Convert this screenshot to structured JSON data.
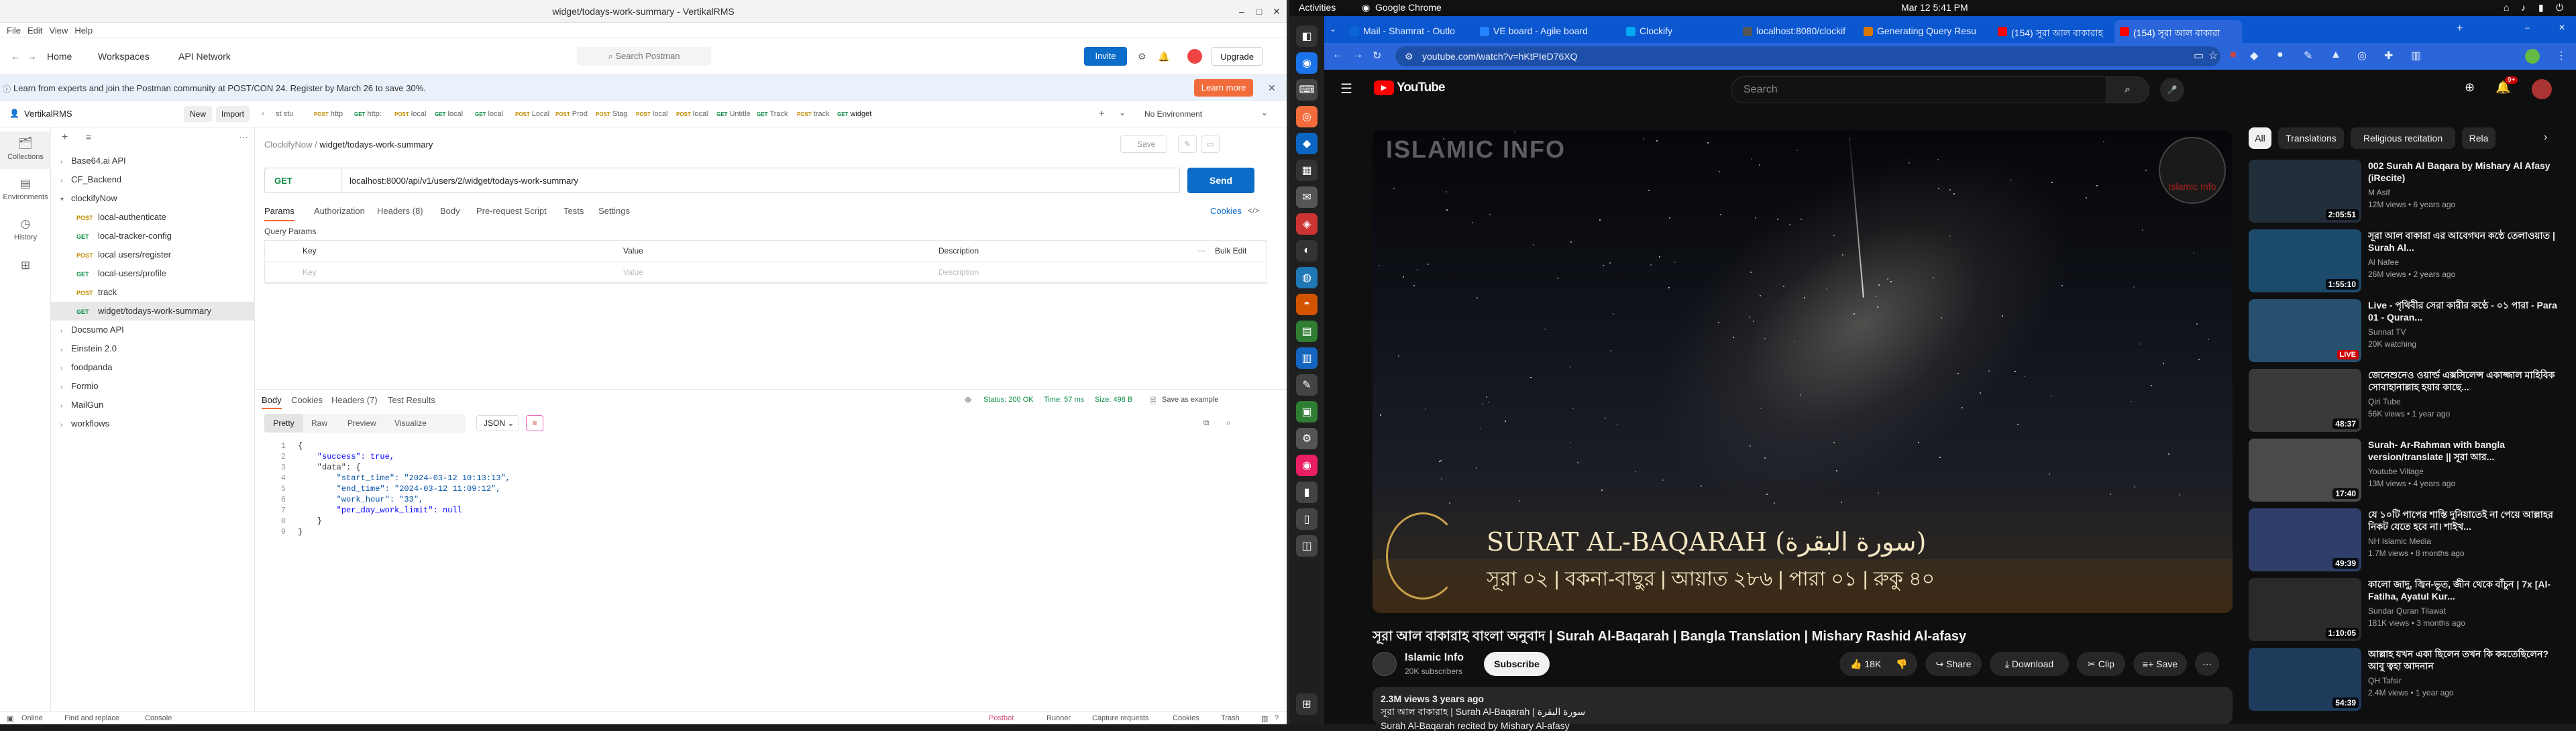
{
  "postman": {
    "window_title": "widget/todays-work-summary - VertikalRMS",
    "menu": [
      "File",
      "Edit",
      "View",
      "Help"
    ],
    "header": {
      "home": "Home",
      "workspaces": "Workspaces",
      "api_network": "API Network",
      "search_placeholder": "Search Postman",
      "invite": "Invite",
      "upgrade": "Upgrade"
    },
    "banner": {
      "text": "Learn from experts and join the Postman community at POST/CON 24. Register by March 26 to save 30%.",
      "button": "Learn more"
    },
    "workspace": {
      "name": "VertikalRMS",
      "new": "New",
      "import": "Import"
    },
    "rail": [
      "Collections",
      "Environments",
      "History"
    ],
    "tree": [
      {
        "type": "folder",
        "label": "Base64.ai API",
        "level": 0
      },
      {
        "type": "folder",
        "label": "CF_Backend",
        "level": 0
      },
      {
        "type": "folder",
        "label": "clockifyNow",
        "level": 0,
        "open": true
      },
      {
        "type": "req",
        "method": "POST",
        "label": "local-authenticate",
        "level": 1
      },
      {
        "type": "req",
        "method": "GET",
        "label": "local-tracker-config",
        "level": 1
      },
      {
        "type": "req",
        "method": "POST",
        "label": "local users/register",
        "level": 1
      },
      {
        "type": "req",
        "method": "GET",
        "label": "local-users/profile",
        "level": 1
      },
      {
        "type": "req",
        "method": "POST",
        "label": "track",
        "level": 1
      },
      {
        "type": "req",
        "method": "GET",
        "label": "widget/todays-work-summary",
        "level": 1,
        "selected": true
      },
      {
        "type": "folder",
        "label": "Docsumo API",
        "level": 0
      },
      {
        "type": "folder",
        "label": "Einstein 2.0",
        "level": 0
      },
      {
        "type": "folder",
        "label": "foodpanda",
        "level": 0
      },
      {
        "type": "folder",
        "label": "Formio",
        "level": 0
      },
      {
        "type": "folder",
        "label": "MailGun",
        "level": 0
      },
      {
        "type": "folder",
        "label": "workflows",
        "level": 0
      }
    ],
    "tabs": [
      {
        "method": "",
        "label": "st stu"
      },
      {
        "method": "POST",
        "label": "http"
      },
      {
        "method": "GET",
        "label": "http:"
      },
      {
        "method": "POST",
        "label": "local"
      },
      {
        "method": "GET",
        "label": "local"
      },
      {
        "method": "GET",
        "label": "local"
      },
      {
        "method": "POST",
        "label": "Local"
      },
      {
        "method": "POST",
        "label": "Prod"
      },
      {
        "method": "POST",
        "label": "Stag"
      },
      {
        "method": "POST",
        "label": "local"
      },
      {
        "method": "POST",
        "label": "local"
      },
      {
        "method": "GET",
        "label": "Untitle"
      },
      {
        "method": "GET",
        "label": "Track"
      },
      {
        "method": "POST",
        "label": "track"
      },
      {
        "method": "GET",
        "label": "widget"
      }
    ],
    "no_environment": "No Environment",
    "breadcrumb": {
      "parent": "ClockifyNow",
      "current": "widget/todays-work-summary"
    },
    "request": {
      "method": "GET",
      "url": "localhost:8000/api/v1/users/2/widget/todays-work-summary",
      "send": "Send",
      "save": "Save"
    },
    "req_tabs": [
      "Params",
      "Authorization",
      "Headers (8)",
      "Body",
      "Pre-request Script",
      "Tests",
      "Settings"
    ],
    "cookies": "Cookies",
    "query_params": {
      "title": "Query Params",
      "headers": [
        "Key",
        "Value",
        "Description"
      ],
      "bulk_edit": "Bulk Edit",
      "placeholder_row": [
        "Key",
        "Value",
        "Description"
      ]
    },
    "resp_tabs": [
      "Body",
      "Cookies",
      "Headers (7)",
      "Test Results"
    ],
    "resp_status": {
      "status": "Status: 200 OK",
      "time": "Time: 57 ms",
      "size": "Size: 498 B",
      "save": "Save as example"
    },
    "resp_views": [
      "Pretty",
      "Raw",
      "Preview",
      "Visualize"
    ],
    "resp_format": "JSON",
    "code_lines": [
      "{",
      "    \"success\": true,",
      "    \"data\": {",
      "        \"start_time\": \"2024-03-12 10:13:13\",",
      "        \"end_time\": \"2024-03-12 11:09:12\",",
      "        \"work_hour\": \"33\",",
      "        \"per_day_work_limit\": null",
      "    }",
      "}"
    ],
    "status_bar": {
      "online": "Online",
      "find": "Find and replace",
      "console": "Console",
      "postbot": "Postbot",
      "runner": "Runner",
      "capture": "Capture requests",
      "cookies": "Cookies",
      "trash": "Trash"
    }
  },
  "system": {
    "activities": "Activities",
    "app": "Google Chrome",
    "datetime": "Mar 12  5:41 PM"
  },
  "chrome": {
    "tabs": [
      {
        "label": "Mail - Shamrat - Outlo",
        "color": "#0a64d6"
      },
      {
        "label": "VE board - Agile board",
        "color": "#2684ff"
      },
      {
        "label": "Clockify",
        "color": "#03a9f4"
      },
      {
        "label": "localhost:8080/clockif",
        "color": "#555555"
      },
      {
        "label": "Generating Query Resu",
        "color": "#d97706"
      },
      {
        "label": "(154) সূরা আল বাকারাহ",
        "color": "#ff0000"
      },
      {
        "label": "(154) সূরা আল বাকারা",
        "color": "#ff0000"
      }
    ],
    "url": "youtube.com/watch?v=hKtPIeD76XQ"
  },
  "youtube": {
    "search_placeholder": "Search",
    "notif_count": "9+",
    "video": {
      "watermark": "ISLAMIC INFO",
      "logo_text": "Islamic Info",
      "overlay_title": "SURAT AL-BAQARAH (سورة البقرة)",
      "overlay_sub": "সূরা ০২ | বকনা-বাছুর | আয়াত ২৮৬ | পারা ০১ | রুকু ৪০"
    },
    "title": "সূরা আল বাকারাহ বাংলা অনুবাদ | Surah Al-Baqarah | Bangla Translation | Mishary Rashid Al-afasy",
    "channel": {
      "name": "Islamic Info",
      "subs": "20K subscribers",
      "subscribe": "Subscribe"
    },
    "actions": {
      "likes": "18K",
      "share": "Share",
      "download": "Download",
      "clip": "Clip",
      "save": "Save"
    },
    "description": {
      "meta": "2.3M views  3 years ago",
      "line1": "সূরা আল বাকারাহ | Surah Al-Baqarah | سورة البقرة",
      "line2": "Surah Al-Baqarah recited by Mishary Al-afasy"
    },
    "chips": [
      "All",
      "Translations",
      "Religious recitation",
      "Rela"
    ],
    "recs": [
      {
        "title": "002 Surah Al Baqara by Mishary Al Afasy (iRecite)",
        "channel": "M Asif",
        "meta": "12M views • 6 years ago",
        "duration": "2:05:51",
        "bg": "#222e3a"
      },
      {
        "title": "সূরা আল বাকারা এর আবেগঘন কন্ঠে তেলাওয়াত | Surah Al...",
        "channel": "Al Nafee",
        "meta": "26M views • 2 years ago",
        "duration": "1:55:10",
        "bg": "#1c4a6b"
      },
      {
        "title": "Live - পৃথিবীর সেরা কারীর কণ্ঠে - ০১ পারা - Para 01 - Quran...",
        "channel": "Sunnat TV",
        "meta": "20K watching",
        "duration": "LIVE",
        "bg": "#27506e"
      },
      {
        "title": "জেনেশুনেও ওয়ার্ল্ড এক্সসিলেন্স একাজ্জাল মাহিবিক সোবাহানাল্লাহ হয়ার কাছে...",
        "channel": "Qiri Tube",
        "meta": "56K views • 1 year ago",
        "duration": "48:37",
        "bg": "#3a3a3a"
      },
      {
        "title": "Surah- Ar-Rahman with bangla version/translate || সূরা আর...",
        "channel": "Youtube Village",
        "meta": "13M views • 4 years ago",
        "duration": "17:40",
        "bg": "#4a4a4a"
      },
      {
        "title": "যে ১০টি পাপের শাস্তি দুনিয়াতেই না পেয়ে আল্লাহর নিকট যেতে হবে না। শাইখ...",
        "channel": "NH Islamic Media",
        "meta": "1.7M views • 8 months ago",
        "duration": "49:39",
        "bg": "#2f3f6a"
      },
      {
        "title": "কালো জাদু, জ্বিন-ভূত, জীন থেকে বাঁচুন | 7x [Al-Fatiha, Ayatul Kur...",
        "channel": "Sundar Quran Tilawat",
        "meta": "181K views • 3 months ago",
        "duration": "1:10:05",
        "bg": "#2a2a2a"
      },
      {
        "title": "আল্লাহ যখন একা ছিলেন তখন কি করতেছিলেন? আবু ত্বহা আদনান",
        "channel": "QH Tafsir",
        "meta": "2.4M views • 1 year ago",
        "duration": "54:39",
        "bg": "#1f3b5c"
      }
    ]
  }
}
